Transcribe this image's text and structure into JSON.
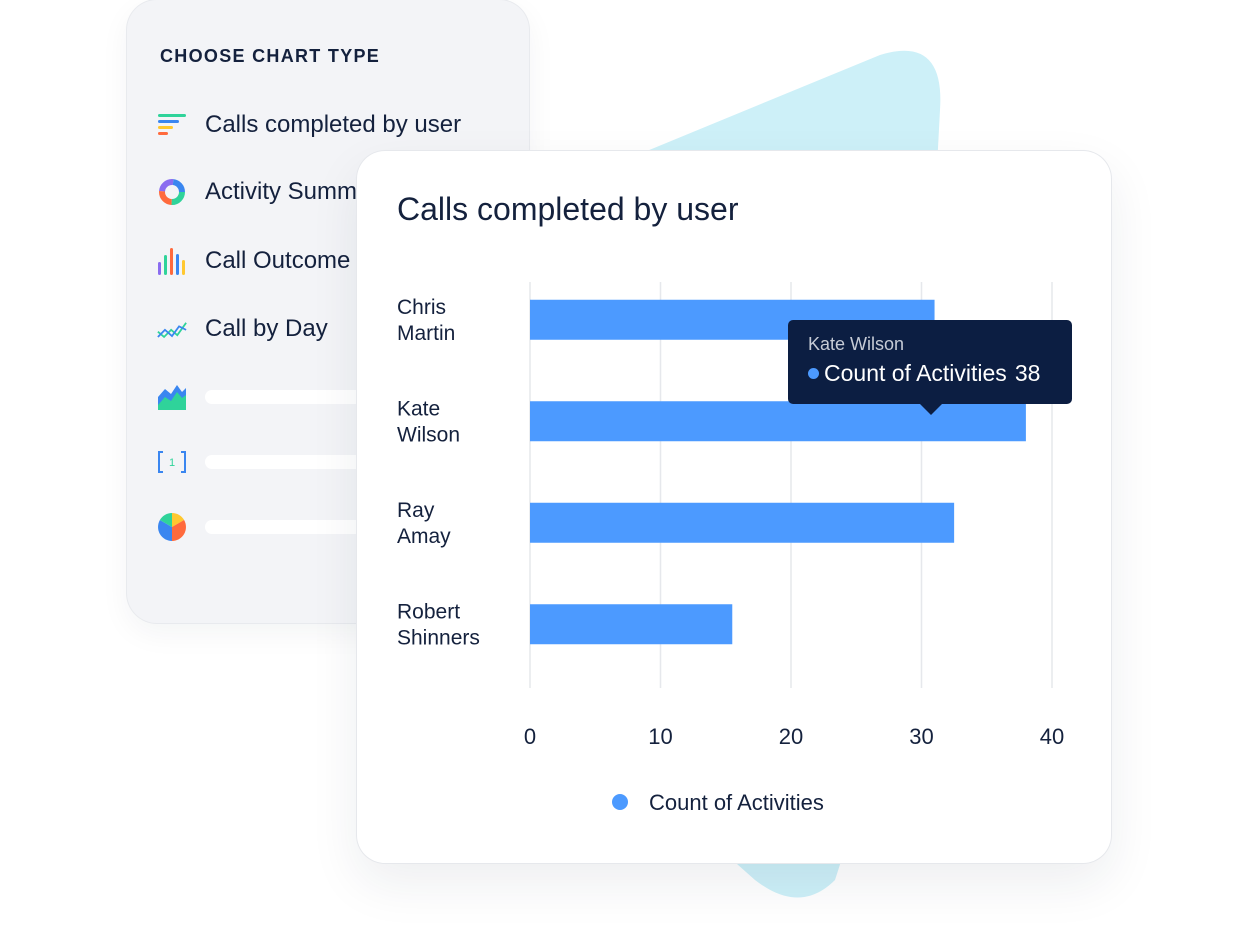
{
  "panel": {
    "title": "CHOOSE CHART TYPE",
    "items": [
      {
        "icon": "horizontal-bar-chart-icon",
        "label": "Calls completed by user"
      },
      {
        "icon": "donut-chart-icon",
        "label": "Activity Summary"
      },
      {
        "icon": "vertical-bar-chart-icon",
        "label": "Call Outcome"
      },
      {
        "icon": "line-chart-icon",
        "label": "Call by Day"
      },
      {
        "icon": "area-chart-icon",
        "label": ""
      },
      {
        "icon": "number-kpi-icon",
        "label": ""
      },
      {
        "icon": "pie-chart-icon",
        "label": ""
      }
    ],
    "kpi_glyph": "1"
  },
  "colors": {
    "bar": "#4c9aff",
    "text": "#14213d",
    "tooltip_bg": "#0c1e42",
    "decor": "#cdf0f8",
    "panel_bg": "#f3f4f7"
  },
  "tooltip": {
    "name": "Kate Wilson",
    "series": "Count of Activities",
    "value": "38"
  },
  "chart_data": {
    "type": "bar",
    "orientation": "horizontal",
    "title": "Calls completed by user",
    "categories": [
      [
        "Chris",
        "Martin"
      ],
      [
        "Kate",
        "Wilson"
      ],
      [
        "Ray",
        "Amay"
      ],
      [
        "Robert",
        "Shinners"
      ]
    ],
    "series": [
      {
        "name": "Count of Activities",
        "values": [
          31,
          38,
          32.5,
          15.5
        ]
      }
    ],
    "xlim": [
      0,
      40
    ],
    "xticks": [
      "0",
      "10",
      "20",
      "30",
      "40"
    ],
    "grid": true,
    "legend": "bottom-center",
    "xlabel": "",
    "ylabel": ""
  }
}
